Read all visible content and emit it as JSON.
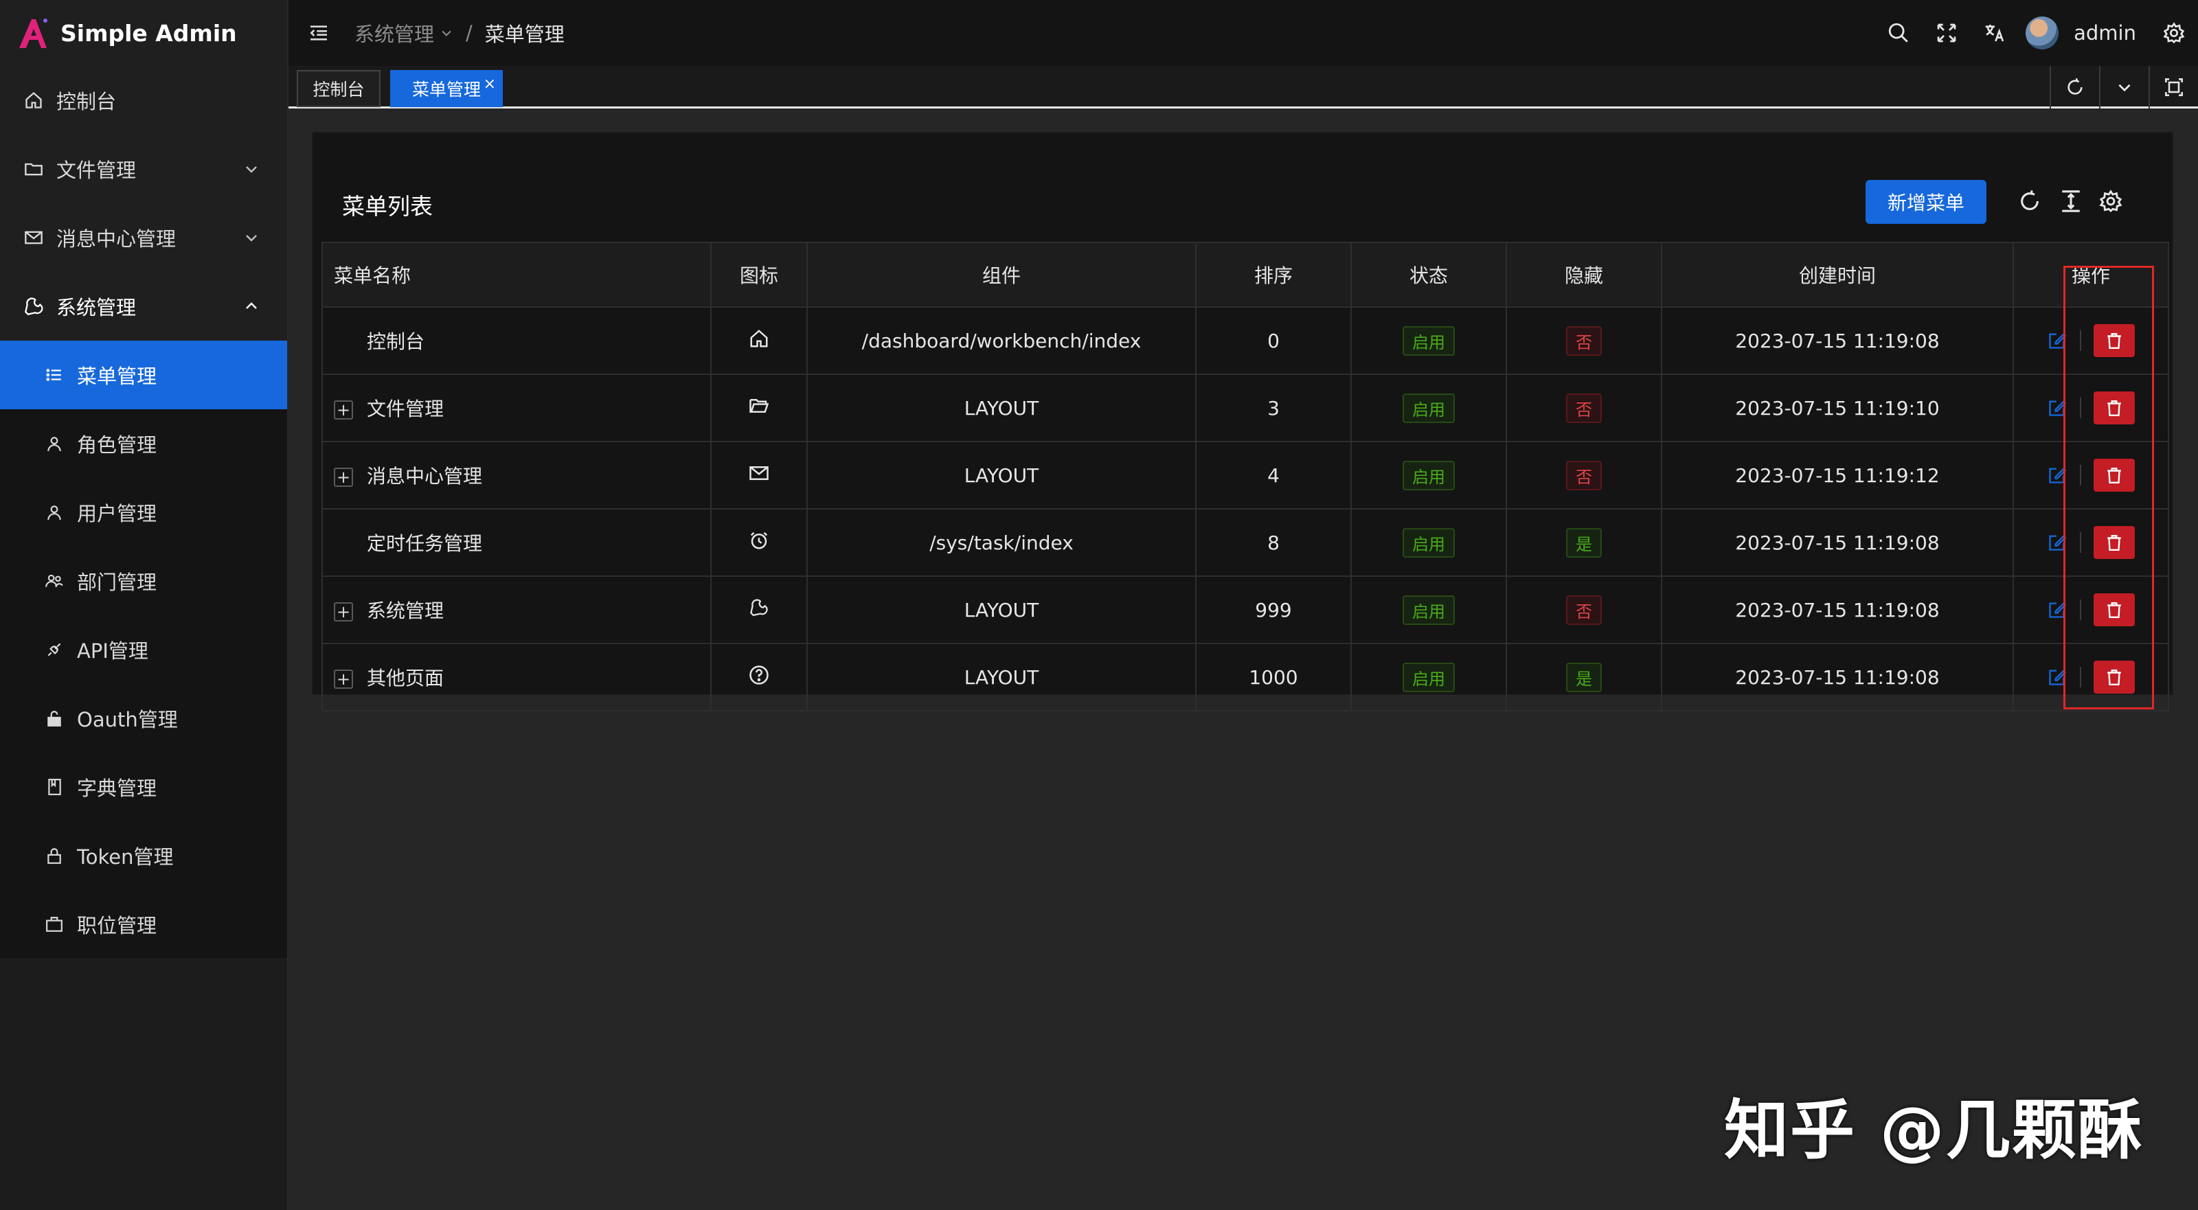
{
  "app": {
    "title": "Simple Admin"
  },
  "sidebar": {
    "items": [
      {
        "label": "控制台",
        "icon": "home-icon"
      },
      {
        "label": "文件管理",
        "icon": "folder-icon",
        "has_children": true
      },
      {
        "label": "消息中心管理",
        "icon": "mail-icon",
        "has_children": true
      },
      {
        "label": "系统管理",
        "icon": "tool-icon",
        "expanded": true
      }
    ],
    "sub_items": [
      {
        "label": "菜单管理",
        "icon": "list-icon",
        "active": true
      },
      {
        "label": "角色管理",
        "icon": "user-icon"
      },
      {
        "label": "用户管理",
        "icon": "user-icon"
      },
      {
        "label": "部门管理",
        "icon": "team-icon"
      },
      {
        "label": "API管理",
        "icon": "api-icon"
      },
      {
        "label": "Oauth管理",
        "icon": "unlock-icon"
      },
      {
        "label": "字典管理",
        "icon": "book-icon"
      },
      {
        "label": "Token管理",
        "icon": "lock-icon"
      },
      {
        "label": "职位管理",
        "icon": "briefcase-icon"
      }
    ]
  },
  "header": {
    "breadcrumb": [
      "系统管理",
      "菜单管理"
    ],
    "username": "admin"
  },
  "tabs": [
    {
      "label": "控制台",
      "active": false
    },
    {
      "label": "菜单管理",
      "active": true,
      "close": "×"
    }
  ],
  "page": {
    "title": "菜单列表",
    "add_button": "新增菜单"
  },
  "table": {
    "columns": [
      "菜单名称",
      "图标",
      "组件",
      "排序",
      "状态",
      "隐藏",
      "创建时间",
      "操作"
    ],
    "rows": [
      {
        "name": "控制台",
        "expandable": false,
        "icon": "home-icon",
        "component": "/dashboard/workbench/index",
        "sort": "0",
        "status": "启用",
        "hidden": "否",
        "created": "2023-07-15 11:19:08"
      },
      {
        "name": "文件管理",
        "expandable": true,
        "icon": "folder-open-icon",
        "component": "LAYOUT",
        "sort": "3",
        "status": "启用",
        "hidden": "否",
        "created": "2023-07-15 11:19:10"
      },
      {
        "name": "消息中心管理",
        "expandable": true,
        "icon": "mail-icon",
        "component": "LAYOUT",
        "sort": "4",
        "status": "启用",
        "hidden": "否",
        "created": "2023-07-15 11:19:12"
      },
      {
        "name": "定时任务管理",
        "expandable": false,
        "icon": "alarm-clock-icon",
        "component": "/sys/task/index",
        "sort": "8",
        "status": "启用",
        "hidden": "是",
        "created": "2023-07-15 11:19:08"
      },
      {
        "name": "系统管理",
        "expandable": true,
        "icon": "tool-icon",
        "component": "LAYOUT",
        "sort": "999",
        "status": "启用",
        "hidden": "否",
        "created": "2023-07-15 11:19:08"
      },
      {
        "name": "其他页面",
        "expandable": true,
        "icon": "question-circle-icon",
        "component": "LAYOUT",
        "sort": "1000",
        "status": "启用",
        "hidden": "是",
        "created": "2023-07-15 11:19:08"
      }
    ]
  },
  "colors": {
    "primary": "#1668dc",
    "danger": "#c41d25",
    "success_tag": "#49aa19",
    "error_tag": "#dc4446",
    "highlight_box": "#e12727"
  },
  "watermark": "知乎 @几颗酥"
}
